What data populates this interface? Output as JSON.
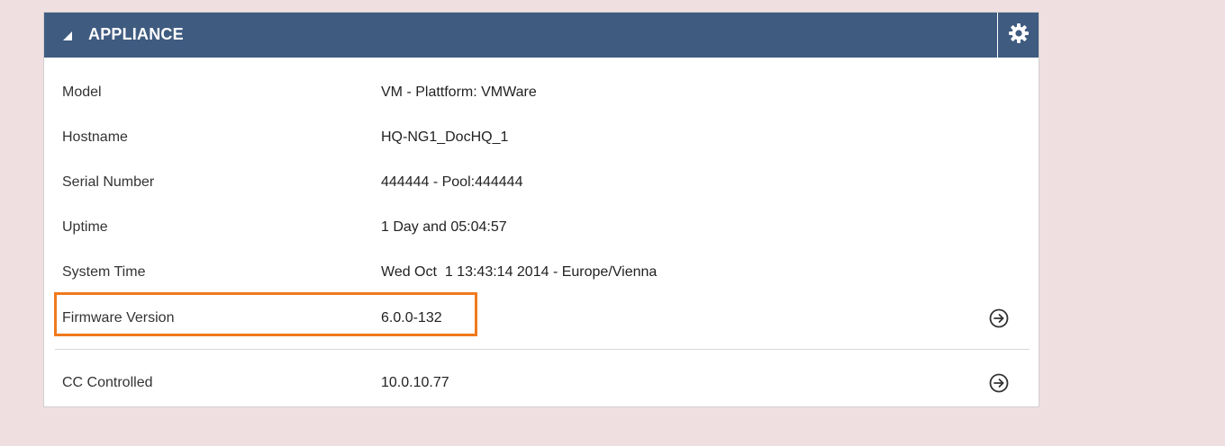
{
  "header": {
    "title": "APPLIANCE",
    "collapse_icon": "triangle-collapse-icon",
    "settings_icon": "gear-icon",
    "background": "#3f5b80"
  },
  "rows": [
    {
      "label": "Model",
      "value": "VM - Plattform: VMWare"
    },
    {
      "label": "Hostname",
      "value": "HQ-NG1_DocHQ_1"
    },
    {
      "label": "Serial Number",
      "value": "444444 - Pool:444444"
    },
    {
      "label": "Uptime",
      "value": "1 Day and 05:04:57"
    },
    {
      "label": "System Time",
      "value": "Wed Oct  1 13:43:14 2014 - Europe/Vienna"
    },
    {
      "label": "Firmware Version",
      "value": "6.0.0-132",
      "has_link": true,
      "highlighted": true
    },
    {
      "label": "CC Controlled",
      "value": "10.0.10.77",
      "has_link": true
    }
  ],
  "colors": {
    "highlight": "#f07a1c",
    "page_background": "#efdfe0"
  }
}
